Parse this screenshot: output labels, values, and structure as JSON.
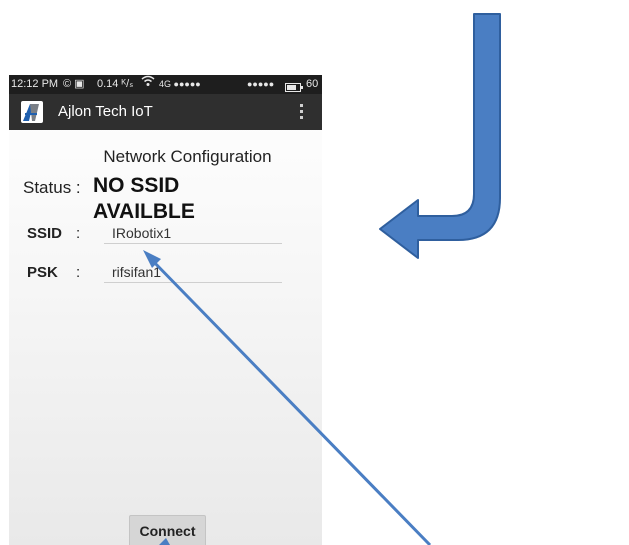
{
  "status_bar": {
    "time": "12:12 PM",
    "icons_left": "© ▣",
    "data_rate": "0.14 ᴷ/ₛ",
    "signal_info": "4G ●●●●●",
    "signal_info_2": "●●●●●",
    "battery": "60"
  },
  "app_bar": {
    "logo_text": "AJ",
    "title": "Ajlon Tech IoT"
  },
  "screen": {
    "title": "Network Configuration",
    "status_label": "Status :",
    "status_value": "NO SSID AVAILBLE",
    "ssid_label": "SSID",
    "ssid_value": "IRobotix1",
    "psk_label": "PSK",
    "psk_value": "rifsifan1",
    "colon": ":",
    "connect_label": "Connect"
  },
  "colors": {
    "annotation_fill": "#4a7ec3",
    "annotation_stroke": "#2f5f9e",
    "app_bar": "#2f2f2f",
    "status_bar": "#1e1e1e"
  },
  "icons": [
    "logo-icon",
    "wifi-icon",
    "battery-icon",
    "overflow-menu-icon"
  ]
}
